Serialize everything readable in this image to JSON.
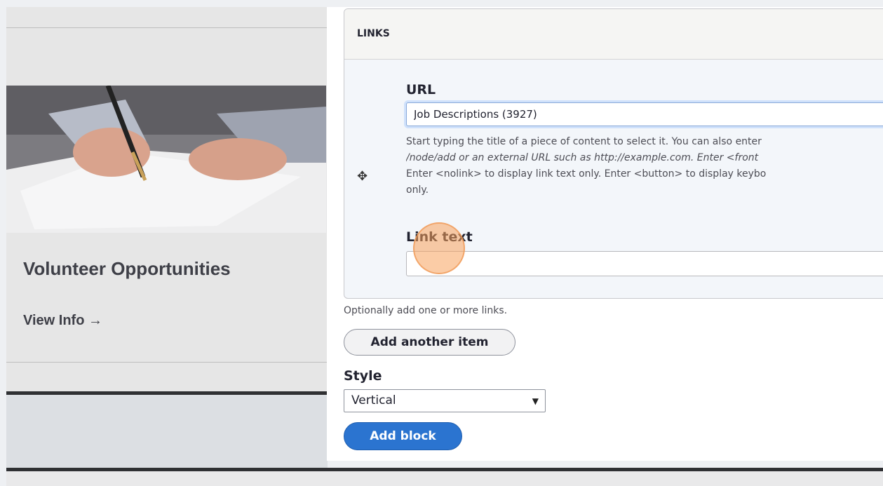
{
  "card": {
    "title": "Volunteer Opportunities",
    "link": "View Info →"
  },
  "links_section": {
    "legend": "LINKS",
    "drag_icon": "✥",
    "url_label": "URL",
    "url_value": "Job Descriptions (3927)",
    "description": [
      "Start typing the title of a piece of content to select it. You can also enter",
      "/node/add or an external URL such as http://example.com. Enter <front",
      "Enter <nolink> to display link text only. Enter <button> to display keybo",
      "only."
    ],
    "link_text_label": "Link text",
    "link_text_value": "",
    "help": "Optionally add one or more links."
  },
  "buttons": {
    "add_another": "Add another item",
    "add_block": "Add block"
  },
  "style": {
    "label": "Style",
    "selected": "Vertical",
    "arrow": "▼"
  }
}
